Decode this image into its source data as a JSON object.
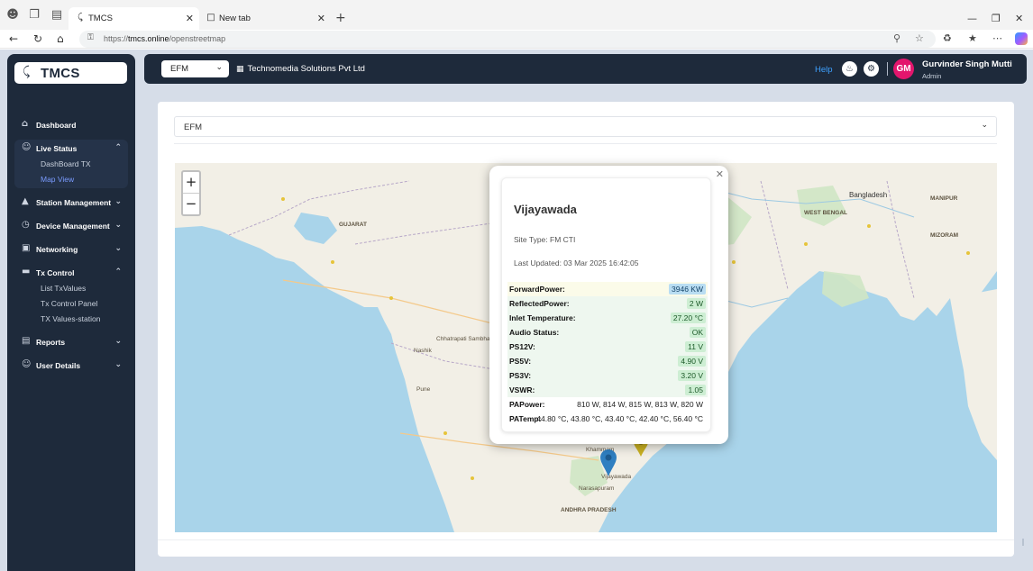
{
  "browser": {
    "tabs": [
      {
        "title": "TMCS",
        "active": true,
        "favicon": "tmcs-icon"
      },
      {
        "title": "New tab",
        "active": false,
        "favicon": "newtab-icon"
      }
    ],
    "url_prefix": "https://",
    "url_host": "tmcs.online",
    "url_path": "/openstreetmap"
  },
  "app": {
    "logo_text": "TMCS",
    "sidebar": {
      "items": [
        {
          "label": "Dashboard",
          "icon": "home-icon"
        },
        {
          "label": "Live Status",
          "icon": "users-icon",
          "expanded": true
        },
        {
          "label": "Station Management",
          "icon": "flask-icon"
        },
        {
          "label": "Device Management",
          "icon": "clock-icon"
        },
        {
          "label": "Networking",
          "icon": "monitor-icon"
        },
        {
          "label": "Tx Control",
          "icon": "folder-icon",
          "expanded": true
        },
        {
          "label": "Reports",
          "icon": "document-icon"
        },
        {
          "label": "User Details",
          "icon": "users-icon"
        }
      ],
      "live_status_children": [
        "DashBoard TX",
        "Map View"
      ],
      "tx_control_children": [
        "List TxValues",
        "Tx Control Panel",
        "TX Values-station"
      ]
    },
    "topbar": {
      "selector_value": "EFM",
      "org_name": "Technomedia Solutions Pvt Ltd",
      "help_label": "Help",
      "user_initials": "GM",
      "user_name": "Gurvinder Singh Mutti",
      "user_role": "Admin"
    },
    "card_selector_value": "EFM"
  },
  "map": {
    "zoom_in": "+",
    "zoom_out": "−",
    "labels": [
      "GUJARAT",
      "Bangladesh",
      "WEST BENGAL",
      "MANIPUR",
      "MIZORAM",
      "ANDHRA PRADESH",
      "Nashik",
      "Pune",
      "Khammam",
      "Vijayawada",
      "Narasapuram",
      "Chhatrapati Sambhajinagar"
    ]
  },
  "popup": {
    "site_name": "Vijayawada",
    "site_type": "Site Type: FM CTI",
    "last_updated": "Last Updated: 03 Mar 2025 16:42:05",
    "rows": [
      {
        "key": "ForwardPower:",
        "value": "3946 KW",
        "style": "blue"
      },
      {
        "key": "ReflectedPower:",
        "value": "2 W",
        "style": "green"
      },
      {
        "key": "Inlet Temperature:",
        "value": "27.20 °C",
        "style": "green"
      },
      {
        "key": "Audio Status:",
        "value": "OK",
        "style": "green"
      },
      {
        "key": "PS12V:",
        "value": "11 V",
        "style": "green"
      },
      {
        "key": "PS5V:",
        "value": "4.90 V",
        "style": "green"
      },
      {
        "key": "PS3V:",
        "value": "3.20 V",
        "style": "green"
      },
      {
        "key": "VSWR:",
        "value": "1.05",
        "style": "green"
      },
      {
        "key": "PAPower:",
        "value": "810 W, 814 W, 815 W, 813 W, 820 W",
        "style": "none"
      },
      {
        "key": "PATemp:",
        "value": "44.80 °C, 43.80 °C, 43.40 °C, 42.40 °C, 56.40 °C",
        "style": "none"
      }
    ]
  },
  "colors": {
    "sidebar_bg": "#1e2a3b",
    "accent_active": "#7a9bff",
    "avatar": "#e3166d",
    "help": "#3ea1ff",
    "sea": "#a9d4ea",
    "land": "#f2efe6"
  }
}
